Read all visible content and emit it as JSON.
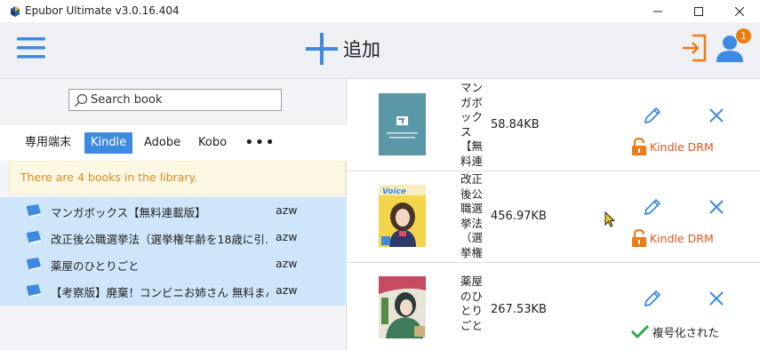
{
  "window": {
    "title": "Epubor Ultimate v3.0.16.404",
    "controls": [
      "minimize",
      "maximize",
      "close"
    ]
  },
  "toolbar": {
    "menu_icon": "hamburger-menu-icon",
    "add_label": "追加",
    "add_icon": "plus-icon",
    "login_icon": "login-icon",
    "user_icon": "user-icon",
    "notification_count": "1",
    "accent_color": "#3e8ae0",
    "orange_color": "#f07c10"
  },
  "search": {
    "placeholder": "Search book",
    "value": ""
  },
  "tabs": [
    {
      "label": "専用端末",
      "selected": false
    },
    {
      "label": "Kindle",
      "selected": true
    },
    {
      "label": "Adobe",
      "selected": false
    },
    {
      "label": "Kobo",
      "selected": false
    },
    {
      "label": "•••",
      "selected": false
    }
  ],
  "library_info": "There are 4 books in the library.",
  "books": [
    {
      "title": "マンガボックス【無料連載版】",
      "format": "azw"
    },
    {
      "title": "改正後公職選挙法（選挙権年齢を18歳に引…",
      "format": "azw"
    },
    {
      "title": "薬屋のひとりごと",
      "format": "azw"
    },
    {
      "title": "【考察版】廃棄！コンビニお姉さん 無料まんが…",
      "format": "azw"
    }
  ],
  "conversion_list": [
    {
      "title": "マンガボックス【無料連載…",
      "size": "58.84KB",
      "status": "Kindle DRM",
      "status_type": "drm",
      "cover": "manga-box-cover"
    },
    {
      "title": "改正後公職選挙法（選挙権年…",
      "size": "456.97KB",
      "status": "Kindle DRM",
      "status_type": "drm",
      "cover": "voice-cover"
    },
    {
      "title": "薬屋のひとりごと",
      "size": "267.53KB",
      "status": "複号化された",
      "status_type": "decrypted",
      "cover": "kusuriya-cover"
    }
  ]
}
